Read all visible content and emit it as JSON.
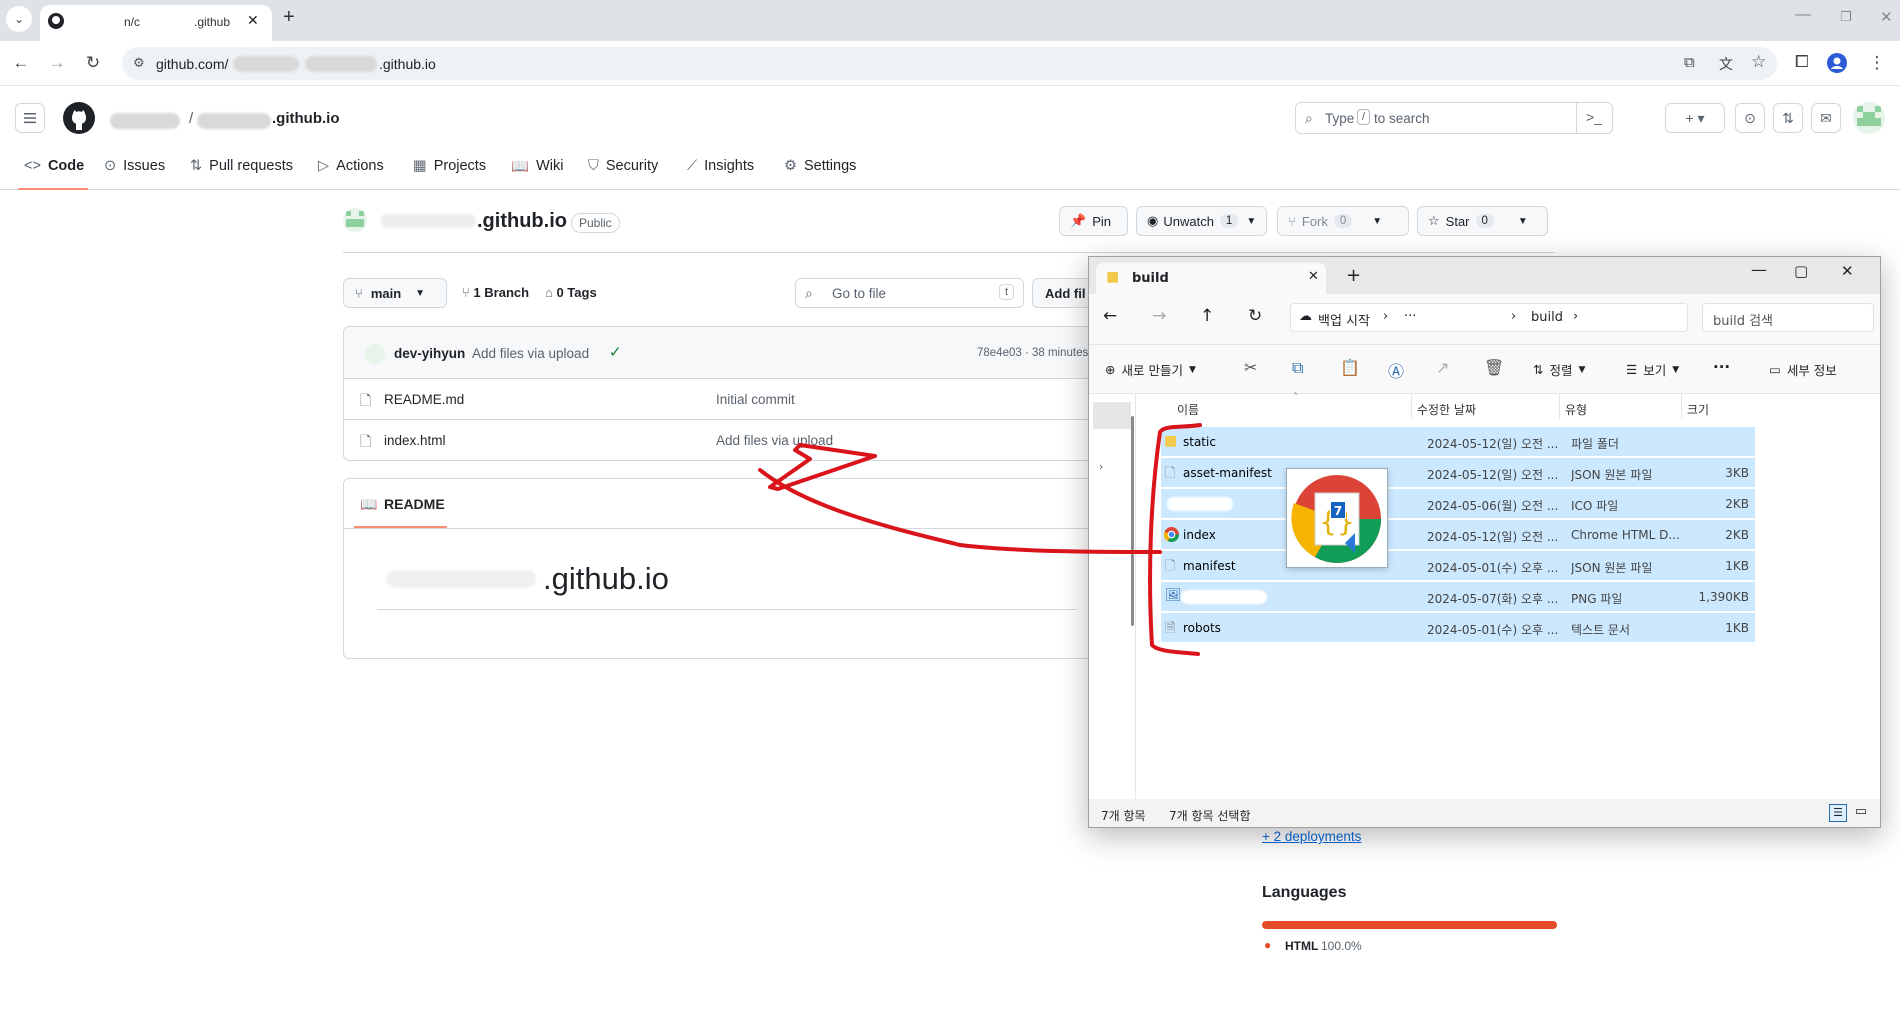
{
  "browser": {
    "tab_title_prefix": "n/c",
    "tab_title_suffix": ".github",
    "url_prefix": "github.com/",
    "url_suffix": ".github.io",
    "tab_close": "✕",
    "new_tab": "+"
  },
  "github": {
    "repo_sep": "/",
    "repo_short": ".github.io",
    "search_placeholder_a": "Type",
    "search_key": "/",
    "search_placeholder_b": "to search",
    "nav": {
      "code": "Code",
      "issues": "Issues",
      "pulls": "Pull requests",
      "actions": "Actions",
      "projects": "Projects",
      "wiki": "Wiki",
      "security": "Security",
      "insights": "Insights",
      "settings": "Settings"
    },
    "repo_title": ".github.io",
    "visibility": "Public",
    "pin": "Pin",
    "unwatch": "Unwatch",
    "unwatch_count": "1",
    "fork": "Fork",
    "fork_count": "0",
    "star": "Star",
    "star_count": "0",
    "branch": "main",
    "branches": "1 Branch",
    "tags": "0 Tags",
    "go_to_file": "Go to file",
    "go_to_file_key": "t",
    "add_file": "Add fil",
    "commit": {
      "author": "dev-yihyun",
      "message": "Add files via upload",
      "hash": "78e4e03 · 38 minutes"
    },
    "files": [
      {
        "name": "README.md",
        "message": "Initial commit"
      },
      {
        "name": "index.html",
        "message": "Add files via upload"
      }
    ],
    "readme_tab": "README",
    "readme_heading": ".github.io",
    "deployments": "+ 2 deployments",
    "languages_title": "Languages",
    "language": "HTML",
    "language_pct": "100.0%",
    "language_fraction": 1.0,
    "language_color": "#e34c26"
  },
  "explorer": {
    "tab_title": "build",
    "breadcrumb_root": "백업 시작",
    "breadcrumb_ellipsis": "···",
    "breadcrumb_folder": "build",
    "search_placeholder": "build 검색",
    "new_label": "새로 만들기",
    "sort_label": "정렬",
    "view_label": "보기",
    "more_label": "···",
    "details_label": "세부 정보",
    "columns": {
      "name": "이름",
      "date": "수정한 날짜",
      "type": "유형",
      "size": "크기"
    },
    "rows": [
      {
        "name": "static",
        "date": "2024-05-12(일) 오전 ...",
        "type": "파일 폴더",
        "size": ""
      },
      {
        "name": "asset-manifest",
        "date": "2024-05-12(일) 오전 ...",
        "type": "JSON 원본 파일",
        "size": "3KB"
      },
      {
        "name": "",
        "date": "2024-05-06(월) 오전 ...",
        "type": "ICO 파일",
        "size": "2KB"
      },
      {
        "name": "index",
        "date": "2024-05-12(일) 오전 ...",
        "type": "Chrome HTML D...",
        "size": "2KB"
      },
      {
        "name": "manifest",
        "date": "2024-05-01(수) 오후 ...",
        "type": "JSON 원본 파일",
        "size": "1KB"
      },
      {
        "name": "",
        "date": "2024-05-07(화) 오후 ...",
        "type": "PNG 파일",
        "size": "1,390KB"
      },
      {
        "name": "robots",
        "date": "2024-05-01(수) 오후 ...",
        "type": "텍스트 문서",
        "size": "1KB"
      }
    ],
    "drag_badge": "7",
    "status_count": "7개 항목",
    "status_selected": "7개 항목 선택함"
  },
  "colors": {
    "accent_tab": "#fd8c73",
    "link": "#0969da",
    "selection": "#cce8ff",
    "annotation": "#d9141b"
  }
}
